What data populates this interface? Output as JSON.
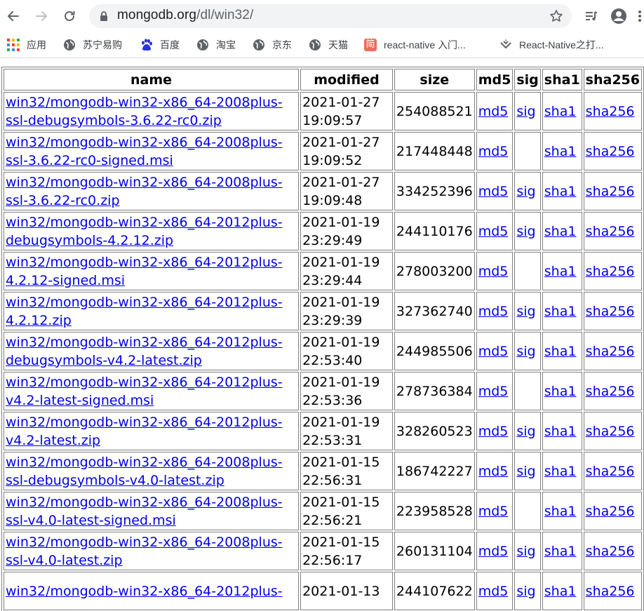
{
  "browser": {
    "url_host": "mongodb.org",
    "url_path": "/dl/win32/",
    "bookmarks": [
      {
        "label": "应用",
        "icon": "apps-grid-icon"
      },
      {
        "label": "苏宁易购",
        "icon": "globe-icon"
      },
      {
        "label": "百度",
        "icon": "baidu-paw-icon"
      },
      {
        "label": "淘宝",
        "icon": "globe-icon"
      },
      {
        "label": "京东",
        "icon": "globe-icon"
      },
      {
        "label": "天猫",
        "icon": "globe-icon"
      },
      {
        "label": "react-native 入门...",
        "icon": "jianshu-icon"
      },
      {
        "label": "React-Native之打...",
        "icon": "juejin-icon"
      }
    ],
    "accent_red": "#ea6f5a"
  },
  "table": {
    "headers": [
      "name",
      "modified",
      "size",
      "md5",
      "sig",
      "sha1",
      "sha256"
    ],
    "rows": [
      {
        "name_line1": "win32/mongodb-win32-x86_64-2008plus-",
        "name_line2": "ssl-debugsymbols-3.6.22-rc0.zip",
        "date": "2021-01-27",
        "time": "19:09:57",
        "size": "254088521",
        "md5": "md5",
        "sig": "sig",
        "sha1": "sha1",
        "sha256": "sha256"
      },
      {
        "name_line1": "win32/mongodb-win32-x86_64-2008plus-",
        "name_line2": "ssl-3.6.22-rc0-signed.msi",
        "date": "2021-01-27",
        "time": "19:09:52",
        "size": "217448448",
        "md5": "md5",
        "sig": "",
        "sha1": "sha1",
        "sha256": "sha256"
      },
      {
        "name_line1": "win32/mongodb-win32-x86_64-2008plus-",
        "name_line2": "ssl-3.6.22-rc0.zip",
        "date": "2021-01-27",
        "time": "19:09:48",
        "size": "334252396",
        "md5": "md5",
        "sig": "sig",
        "sha1": "sha1",
        "sha256": "sha256"
      },
      {
        "name_line1": "win32/mongodb-win32-x86_64-2012plus-",
        "name_line2": "debugsymbols-4.2.12.zip",
        "date": "2021-01-19",
        "time": "23:29:49",
        "size": "244110176",
        "md5": "md5",
        "sig": "sig",
        "sha1": "sha1",
        "sha256": "sha256"
      },
      {
        "name_line1": "win32/mongodb-win32-x86_64-2012plus-",
        "name_line2": "4.2.12-signed.msi",
        "date": "2021-01-19",
        "time": "23:29:44",
        "size": "278003200",
        "md5": "md5",
        "sig": "",
        "sha1": "sha1",
        "sha256": "sha256"
      },
      {
        "name_line1": "win32/mongodb-win32-x86_64-2012plus-",
        "name_line2": "4.2.12.zip",
        "date": "2021-01-19",
        "time": "23:29:39",
        "size": "327362740",
        "md5": "md5",
        "sig": "sig",
        "sha1": "sha1",
        "sha256": "sha256"
      },
      {
        "name_line1": "win32/mongodb-win32-x86_64-2012plus-",
        "name_line2": "debugsymbols-v4.2-latest.zip",
        "date": "2021-01-19",
        "time": "22:53:40",
        "size": "244985506",
        "md5": "md5",
        "sig": "sig",
        "sha1": "sha1",
        "sha256": "sha256"
      },
      {
        "name_line1": "win32/mongodb-win32-x86_64-2012plus-",
        "name_line2": "v4.2-latest-signed.msi",
        "date": "2021-01-19",
        "time": "22:53:36",
        "size": "278736384",
        "md5": "md5",
        "sig": "",
        "sha1": "sha1",
        "sha256": "sha256"
      },
      {
        "name_line1": "win32/mongodb-win32-x86_64-2012plus-",
        "name_line2": "v4.2-latest.zip",
        "date": "2021-01-19",
        "time": "22:53:31",
        "size": "328260523",
        "md5": "md5",
        "sig": "sig",
        "sha1": "sha1",
        "sha256": "sha256"
      },
      {
        "name_line1": "win32/mongodb-win32-x86_64-2008plus-",
        "name_line2": "ssl-debugsymbols-v4.0-latest.zip",
        "date": "2021-01-15",
        "time": "22:56:31",
        "size": "186742227",
        "md5": "md5",
        "sig": "sig",
        "sha1": "sha1",
        "sha256": "sha256"
      },
      {
        "name_line1": "win32/mongodb-win32-x86_64-2008plus-",
        "name_line2": "ssl-v4.0-latest-signed.msi",
        "date": "2021-01-15",
        "time": "22:56:21",
        "size": "223958528",
        "md5": "md5",
        "sig": "",
        "sha1": "sha1",
        "sha256": "sha256"
      },
      {
        "name_line1": "win32/mongodb-win32-x86_64-2008plus-",
        "name_line2": "ssl-v4.0-latest.zip",
        "date": "2021-01-15",
        "time": "22:56:17",
        "size": "260131104",
        "md5": "md5",
        "sig": "sig",
        "sha1": "sha1",
        "sha256": "sha256"
      },
      {
        "name_line1": "win32/mongodb-win32-x86_64-2012plus-",
        "name_line2": "",
        "date": "2021-01-13",
        "time": "",
        "size": "244107622",
        "md5": "md5",
        "sig": "sig",
        "sha1": "sha1",
        "sha256": "sha256"
      }
    ]
  }
}
